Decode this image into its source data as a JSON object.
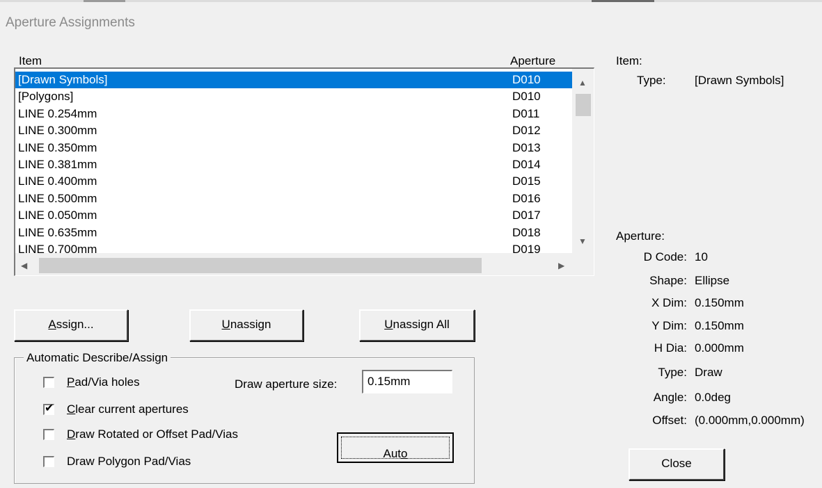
{
  "window": {
    "title": "Aperture Assignments"
  },
  "list": {
    "col_item": "Item",
    "col_aperture": "Aperture",
    "rows": [
      {
        "item": "[Drawn Symbols]",
        "aperture": "D010"
      },
      {
        "item": "[Polygons]",
        "aperture": "D010"
      },
      {
        "item": "LINE 0.254mm",
        "aperture": "D011"
      },
      {
        "item": "LINE 0.300mm",
        "aperture": "D012"
      },
      {
        "item": "LINE 0.350mm",
        "aperture": "D013"
      },
      {
        "item": "LINE 0.381mm",
        "aperture": "D014"
      },
      {
        "item": "LINE 0.400mm",
        "aperture": "D015"
      },
      {
        "item": "LINE 0.500mm",
        "aperture": "D016"
      },
      {
        "item": "LINE 0.050mm",
        "aperture": "D017"
      },
      {
        "item": "LINE 0.635mm",
        "aperture": "D018"
      },
      {
        "item": "LINE 0.700mm",
        "aperture": "D019"
      }
    ],
    "selected_index": 0
  },
  "buttons": {
    "assign_u": "A",
    "assign_rest": "ssign...",
    "unassign_u": "U",
    "unassign_rest": "nassign",
    "unassign_all_u": "U",
    "unassign_all_rest": "nassign All",
    "auto_a": "Aut",
    "auto_u": "o",
    "close": "Close"
  },
  "auto_group": {
    "title": "Automatic Describe/Assign",
    "pad_via_holes": {
      "u": "P",
      "rest": "ad/Via holes",
      "checked": false
    },
    "clear_current": {
      "u": "C",
      "rest": "lear current apertures",
      "checked": true
    },
    "draw_rotated": {
      "u": "D",
      "rest": "raw Rotated or Offset Pad/Vias",
      "checked": false
    },
    "draw_polygon": {
      "label": "Draw Polygon Pad/Vias",
      "checked": false
    },
    "draw_size_label": "Draw aperture size:",
    "draw_size_value": "0.15mm"
  },
  "item_info": {
    "heading": "Item:",
    "type_label": "Type:",
    "type_value": "[Drawn Symbols]"
  },
  "aperture_info": {
    "heading": "Aperture:",
    "fields": [
      {
        "label": "D Code:",
        "value": "10"
      },
      {
        "label": "Shape:",
        "value": "Ellipse"
      },
      {
        "label": "X Dim:",
        "value": "0.150mm"
      },
      {
        "label": "Y Dim:",
        "value": "0.150mm"
      },
      {
        "label": "H Dia:",
        "value": "0.000mm"
      },
      {
        "label": "Type:",
        "value": "Draw"
      },
      {
        "label": "Angle:",
        "value": "0.0deg"
      },
      {
        "label": "Offset:",
        "value": "(0.000mm,0.000mm)"
      }
    ]
  },
  "icons": {
    "scroll_up": "▲",
    "scroll_down": "▼",
    "scroll_left": "◀",
    "scroll_right": "▶",
    "check": "✔"
  },
  "colors": {
    "selection": "#0078d7",
    "face": "#f0f0f0",
    "title_text": "#8a8a8a"
  }
}
